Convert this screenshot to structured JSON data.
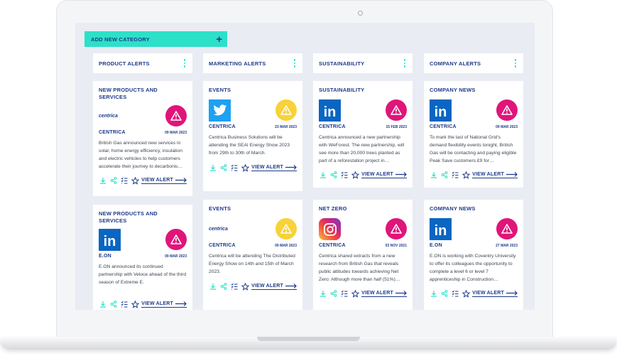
{
  "toolbar": {
    "add_category_label": "ADD NEW CATEGORY"
  },
  "columns": [
    {
      "title": "PRODUCT ALERTS"
    },
    {
      "title": "MARKETING ALERTS"
    },
    {
      "title": "SUSTAINABILITY"
    },
    {
      "title": "COMPANY ALERTS"
    }
  ],
  "cards": [
    {
      "category": "NEW PRODUCTS AND SERVICES",
      "logo": "centrica-logo",
      "logo_text": "centrica",
      "alert_color": "#e0157a",
      "source": "CENTRICA",
      "date": "09 MAR 2023",
      "snippet": "British Gas announced new services in solar, home energy efficiency, insulation and electric vehicles to help customers accelerate their journey to decarbonis…",
      "action": "VIEW ALERT"
    },
    {
      "category": "NEW PRODUCTS AND SERVICES",
      "logo": "linkedin-logo",
      "logo_text": "in",
      "alert_color": "#e0157a",
      "source": "E.ON",
      "date": "09 MAR 2023",
      "snippet": "E.ON announced its continued partnership with Veloce ahead of the third season of Extreme E.",
      "action": "VIEW ALERT"
    },
    {
      "category": "EVENTS",
      "logo": "twitter-logo",
      "logo_text": "",
      "alert_color": "#f7d23a",
      "source": "CENTRICA",
      "date": "23 MAR 2023",
      "snippet": "Centrica Business Solutions will be attending the SEAI Energy Show 2023 from 29th to 30th of March.",
      "action": "VIEW ALERT"
    },
    {
      "category": "EVENTS",
      "logo": "centrica-logo",
      "logo_text": "centrica",
      "alert_color": "#f7d23a",
      "source": "CENTRICA",
      "date": "09 MAR 2023",
      "snippet": "Centrica will be attending The Distributed Energy Show on 14th and 15th of March 2023.",
      "action": "VIEW ALERT"
    },
    {
      "category": "SUSTAINABILITY",
      "logo": "linkedin-logo",
      "logo_text": "in",
      "alert_color": "#e0157a",
      "source": "CENTRICA",
      "date": "15 FEB 2023",
      "snippet": "Centrica announced a new partnership with WeForest. The new partnership, will see more than 20,000 trees planted as part of a reforestation project in…",
      "action": "VIEW ALERT"
    },
    {
      "category": "NET ZERO",
      "logo": "instagram-logo",
      "logo_text": "",
      "alert_color": "#e0157a",
      "source": "CENTRICA",
      "date": "03 NOV 2021",
      "snippet": "Centrica shared extracts from a new research from British Gas that reveals public attitudes towards achieving Net Zero: Although more than half (51%)…",
      "action": "VIEW ALERT"
    },
    {
      "category": "COMPANY NEWS",
      "logo": "linkedin-logo",
      "logo_text": "in",
      "alert_color": "#e0157a",
      "source": "CENTRICA",
      "date": "09 MAR 2023",
      "snippet": "To mark the last of National Grid's demand flexibility events tonight, British Gas will be contacting and paying eligible Peak Save customers £9 for…",
      "action": "VIEW ALERT"
    },
    {
      "category": "COMPANY NEWS",
      "logo": "linkedin-logo",
      "logo_text": "in",
      "alert_color": "#e0157a",
      "source": "E.ON",
      "date": "27 MAR 2023",
      "snippet": "E.ON is working with Coventry University to offer its colleagues the opportunity to complete a level 6 or level 7 apprenticeship in Construction…",
      "action": "VIEW ALERT"
    }
  ],
  "colors": {
    "accent": "#2de0c8",
    "navy": "#1e3a8a",
    "alert_pink": "#e0157a",
    "alert_yellow": "#f7d23a",
    "linkedin": "#0a66c2",
    "twitter": "#1da1f2"
  }
}
